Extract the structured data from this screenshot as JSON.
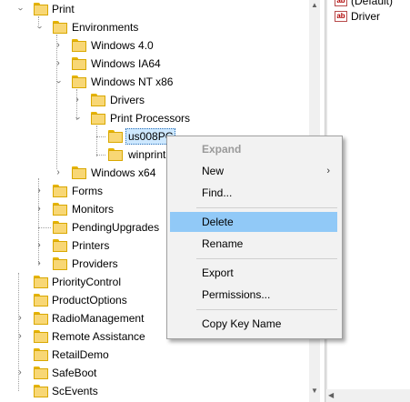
{
  "tree": {
    "nodes": [
      {
        "id": "print",
        "label": "Print",
        "expander": "down"
      },
      {
        "id": "environments",
        "label": "Environments",
        "expander": "down"
      },
      {
        "id": "windows-4-0",
        "label": "Windows 4.0",
        "expander": "right"
      },
      {
        "id": "windows-ia64",
        "label": "Windows IA64",
        "expander": "right"
      },
      {
        "id": "windows-nt-x86",
        "label": "Windows NT x86",
        "expander": "down"
      },
      {
        "id": "drivers",
        "label": "Drivers",
        "expander": "right"
      },
      {
        "id": "print-processors",
        "label": "Print Processors",
        "expander": "down"
      },
      {
        "id": "us008pc",
        "label": "us008PC",
        "expander": "none",
        "selected": true
      },
      {
        "id": "winprint",
        "label": "winprint",
        "expander": "none"
      },
      {
        "id": "windows-x64",
        "label": "Windows x64",
        "expander": "right"
      },
      {
        "id": "forms",
        "label": "Forms",
        "expander": "right"
      },
      {
        "id": "monitors",
        "label": "Monitors",
        "expander": "right"
      },
      {
        "id": "pendingupgrades",
        "label": "PendingUpgrades",
        "expander": "none"
      },
      {
        "id": "printers",
        "label": "Printers",
        "expander": "right"
      },
      {
        "id": "providers",
        "label": "Providers",
        "expander": "right"
      },
      {
        "id": "prioritycontrol",
        "label": "PriorityControl",
        "expander": "none"
      },
      {
        "id": "productoptions",
        "label": "ProductOptions",
        "expander": "none"
      },
      {
        "id": "radiomanagement",
        "label": "RadioManagement",
        "expander": "right"
      },
      {
        "id": "remote-assistance",
        "label": "Remote Assistance",
        "expander": "right"
      },
      {
        "id": "retaildemo",
        "label": "RetailDemo",
        "expander": "none"
      },
      {
        "id": "safeboot",
        "label": "SafeBoot",
        "expander": "right"
      },
      {
        "id": "scevents",
        "label": "ScEvents",
        "expander": "none"
      }
    ]
  },
  "values": {
    "rows": [
      {
        "name": "(Default)",
        "icon": "string-value-icon"
      },
      {
        "name": "Driver",
        "icon": "string-value-icon"
      }
    ]
  },
  "context_menu": {
    "items": [
      {
        "label": "Expand",
        "disabled": true
      },
      {
        "label": "New",
        "submenu": true
      },
      {
        "label": "Find..."
      },
      {
        "label": "Delete",
        "highlighted": true
      },
      {
        "label": "Rename"
      },
      {
        "label": "Export"
      },
      {
        "label": "Permissions..."
      },
      {
        "label": "Copy Key Name"
      }
    ]
  },
  "icons": {
    "expander_right": "chevron-right-icon",
    "expander_down": "chevron-down-icon",
    "folder": "folder-icon",
    "value": "ab-string-icon",
    "submenu_arrow": "submenu-arrow-icon",
    "ab_glyph": "ab"
  },
  "colors": {
    "menu_highlight": "#91c9f7",
    "selection": "#cde8ff",
    "folder": "#f8d775"
  }
}
